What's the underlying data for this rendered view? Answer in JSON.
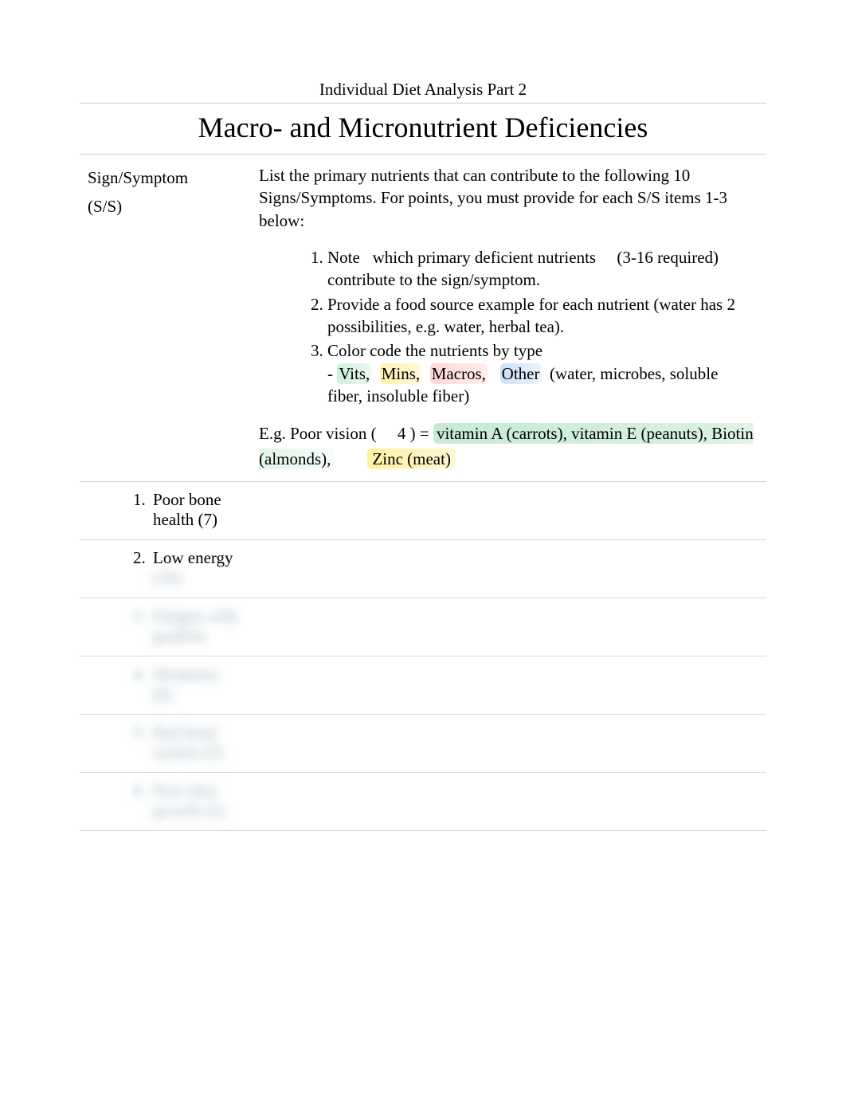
{
  "doc_title": "Individual Diet Analysis Part 2",
  "main_heading": "Macro- and Micronutrient Deficiencies",
  "header": {
    "left_label1": "Sign/Symptom",
    "left_label2": "(S/S)",
    "intro": "List the primary nutrients that can contribute to the following 10 Signs/Symptoms. For points, you must provide for each S/S items 1-3 below:",
    "instructions": [
      {
        "pre": "Note ",
        "mid": "which primary deficient nutrients",
        "post": " (3-16 required) contribute to the sign/symptom."
      },
      {
        "text": "Provide a food source example for each nutrient (water has 2 possibilities, e.g. water, herbal tea)."
      },
      {
        "text_pre": "Color code the nutrients by type",
        "dash": "- ",
        "vits": "Vits,",
        "mins": "Mins,",
        "macros": "Macros,",
        "other": "Other",
        "tail": " (water, microbes, soluble fiber, insoluble fiber)"
      }
    ],
    "example": {
      "pre": "E.g. Poor vision (",
      "count": "4",
      "mid": " ) = ",
      "green": "vitamin A (carrots), vitamin E (peanuts), Biotin (almonds),",
      "yellow": "Zinc (meat)"
    }
  },
  "rows": [
    {
      "num": "1.",
      "text": "Poor bone health (7)",
      "blurred": false
    },
    {
      "num": "2.",
      "text": "Low energy (16)",
      "blurred": false,
      "semi_tail": true
    },
    {
      "num": "3.",
      "text": "Fatigue with goallots",
      "blurred": true
    },
    {
      "num": "4.",
      "text": "Weakness (6)",
      "blurred": true
    },
    {
      "num": "5.",
      "text": "Bad heart system (5)",
      "blurred": true
    },
    {
      "num": "6.",
      "text": "Poor skin growth (3)",
      "blurred": true
    }
  ]
}
